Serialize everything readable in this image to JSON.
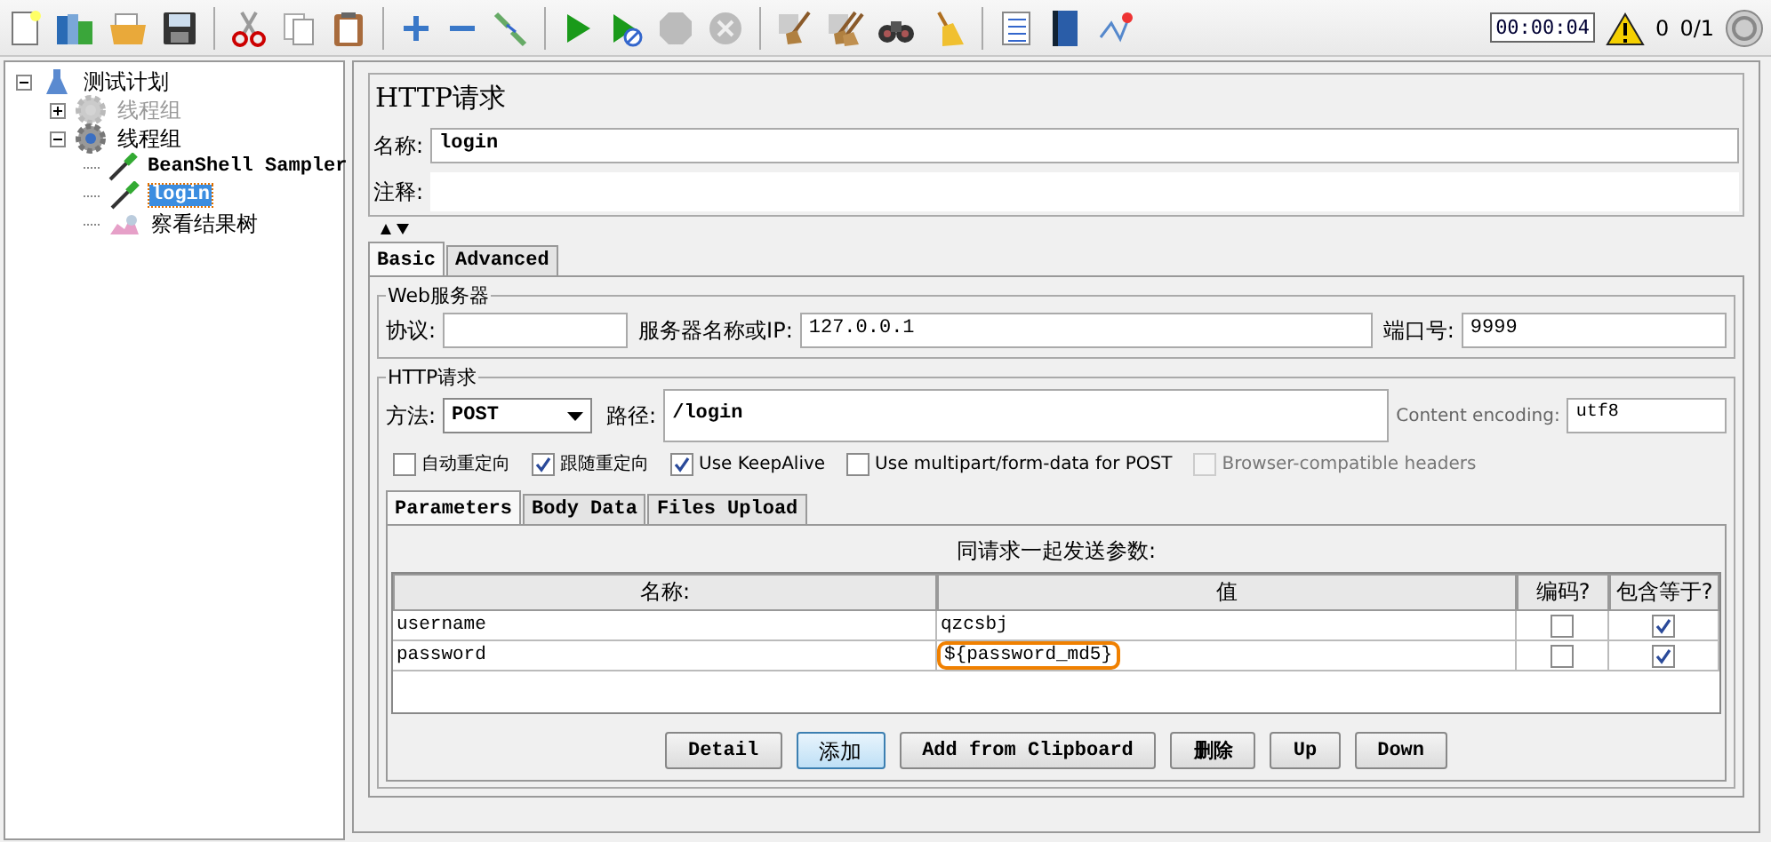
{
  "toolbar": {
    "timer": "00:00:04",
    "warning_count": "0",
    "threads": "0/1"
  },
  "tree": [
    {
      "label": "测试计划",
      "kind": "plan",
      "expanded": true,
      "selected": false,
      "disabled": false,
      "children": [
        {
          "label": "线程组",
          "kind": "thread-group",
          "expanded": false,
          "selected": false,
          "disabled": true
        },
        {
          "label": "线程组",
          "kind": "thread-group",
          "expanded": true,
          "selected": false,
          "disabled": false,
          "children": [
            {
              "label": "BeanShell Sampler",
              "kind": "sampler",
              "selected": false,
              "disabled": false
            },
            {
              "label": "login",
              "kind": "sampler",
              "selected": true,
              "disabled": false
            },
            {
              "label": "察看结果树",
              "kind": "listener",
              "selected": false,
              "disabled": false
            }
          ]
        }
      ]
    }
  ],
  "panel": {
    "title": "HTTP请求",
    "name_label": "名称:",
    "name_value": "login",
    "comment_label": "注释:",
    "tabs": [
      {
        "label": "Basic",
        "selected": true
      },
      {
        "label": "Advanced",
        "selected": false
      }
    ],
    "web_server": {
      "legend": "Web服务器",
      "protocol_label": "协议:",
      "server_label": "服务器名称或IP:",
      "server_value": "127.0.0.1",
      "port_label": "端口号:",
      "port_value": "9999"
    },
    "http_request": {
      "legend": "HTTP请求",
      "method_label": "方法:",
      "method": "POST",
      "path_label": "路径:",
      "path": "/login",
      "encoding_label": "Content encoding:",
      "encoding": "utf8",
      "checkboxes": [
        {
          "label": "自动重定向",
          "checked": false,
          "disabled": false
        },
        {
          "label": "跟随重定向",
          "checked": true,
          "disabled": false
        },
        {
          "label": "Use KeepAlive",
          "checked": true,
          "disabled": false
        },
        {
          "label": "Use multipart/form-data for POST",
          "checked": false,
          "disabled": false
        },
        {
          "label": "Browser-compatible headers",
          "checked": false,
          "disabled": true
        }
      ]
    },
    "param_tabs": [
      {
        "label": "Parameters",
        "selected": true
      },
      {
        "label": "Body Data",
        "selected": false
      },
      {
        "label": "Files Upload",
        "selected": false
      }
    ],
    "table": {
      "caption": "同请求一起发送参数:",
      "columns": [
        "名称:",
        "值",
        "编码?",
        "包含等于?"
      ],
      "rows": [
        {
          "name": "username",
          "value": "qzcsbj",
          "encode": false,
          "include_equals": true,
          "highlighted": false
        },
        {
          "name": "password",
          "value": "${password_md5}",
          "encode": false,
          "include_equals": true,
          "highlighted": true
        }
      ]
    },
    "buttons": [
      {
        "label": "Detail",
        "focused": false
      },
      {
        "label": "添加",
        "focused": true
      },
      {
        "label": "Add from Clipboard",
        "focused": false
      },
      {
        "label": "删除",
        "focused": false
      },
      {
        "label": "Up",
        "focused": false
      },
      {
        "label": "Down",
        "focused": false
      }
    ]
  }
}
